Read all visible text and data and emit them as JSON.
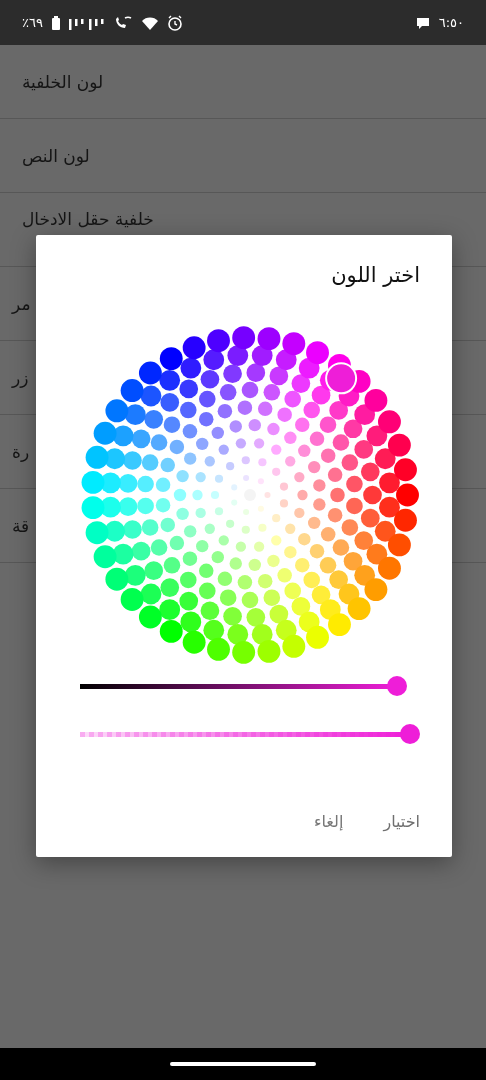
{
  "status_bar": {
    "battery": "٪٦٩",
    "time": "٦:٥٠"
  },
  "settings_list": [
    {
      "label": "لون الخلفية"
    },
    {
      "label": "لون النص"
    },
    {
      "label": "خلفية حقل الادخال"
    },
    {
      "label": "مر"
    },
    {
      "label": "زر"
    },
    {
      "label": "رة"
    },
    {
      "label": "قة"
    }
  ],
  "dialog": {
    "title": "اختر اللون",
    "lightness_slider": {
      "level": 0.96
    },
    "alpha_slider": {
      "level": 1
    },
    "buttons": [
      {
        "label": "اختيار",
        "kind": "confirm"
      },
      {
        "label": "إلغاء",
        "kind": "cancel"
      }
    ]
  }
}
